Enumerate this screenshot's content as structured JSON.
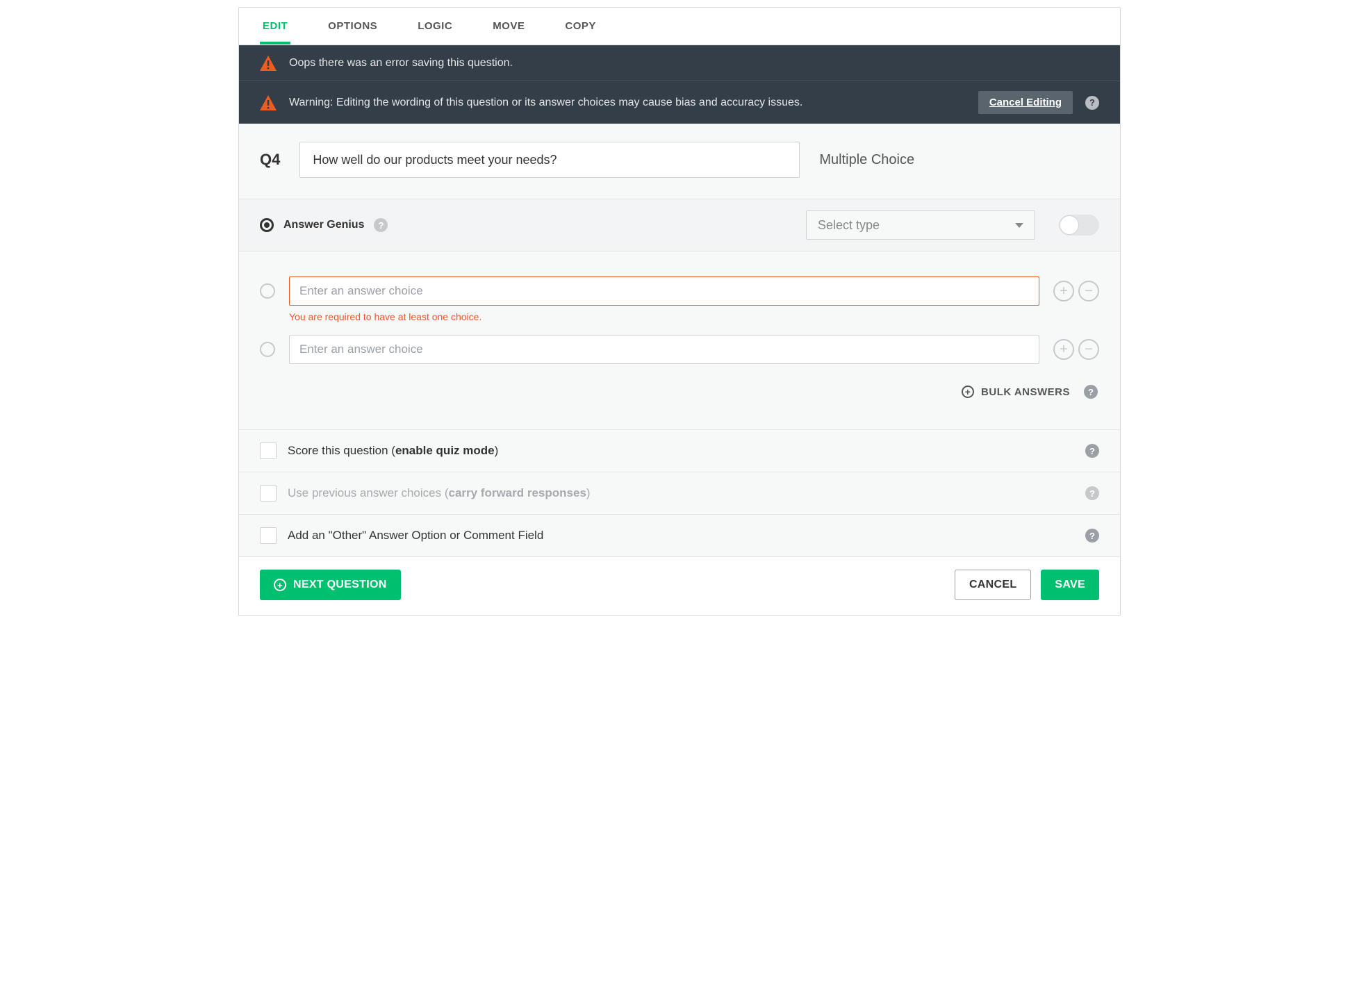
{
  "tabs": {
    "edit": "EDIT",
    "options": "OPTIONS",
    "logic": "LOGIC",
    "move": "MOVE",
    "copy": "COPY"
  },
  "alerts": {
    "error": "Oops there was an error saving this question.",
    "warning": "Warning: Editing the wording of this question or its answer choices may cause bias and accuracy issues.",
    "cancel_editing": "Cancel Editing"
  },
  "question": {
    "number": "Q4",
    "text": "How well do our products meet your needs?",
    "type_label": "Multiple Choice"
  },
  "genius": {
    "title": "Answer Genius",
    "select_placeholder": "Select type"
  },
  "choices": {
    "placeholder": "Enter an answer choice",
    "error_msg": "You are required to have at least one choice.",
    "bulk_label": "BULK ANSWERS"
  },
  "options": {
    "score_pre": "Score this question (",
    "score_bold": "enable quiz mode",
    "score_post": ")",
    "carry_pre": "Use previous answer choices (",
    "carry_bold": "carry forward responses",
    "carry_post": ")",
    "other": "Add an \"Other\" Answer Option or Comment Field"
  },
  "footer": {
    "next": "NEXT QUESTION",
    "cancel": "CANCEL",
    "save": "SAVE"
  }
}
